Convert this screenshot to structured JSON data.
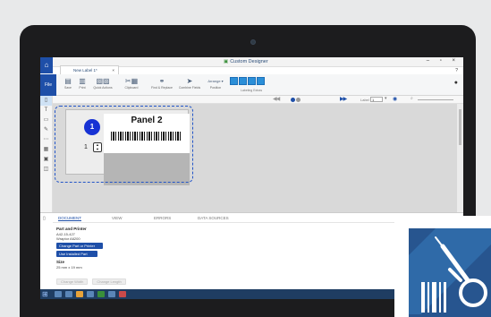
{
  "window": {
    "app_title": "Custom Designer",
    "controls": "– ▫ ×"
  },
  "document_tab": {
    "label": "New Label 1*",
    "close": "×"
  },
  "ribbon": {
    "file_label": "File",
    "buttons": [
      {
        "label": "Save",
        "icon": "save-icon"
      },
      {
        "label": "Print",
        "icon": "printer-icon"
      },
      {
        "label": "Quick Actions",
        "icon": "quick-actions-icon"
      },
      {
        "label": "Clipboard",
        "icon": "clipboard-icon"
      },
      {
        "label": "Find & Replace",
        "icon": "binoculars-icon"
      },
      {
        "label": "Combine Fields",
        "icon": "arrow-right-icon"
      },
      {
        "label": "Arrange",
        "icon": "arrange-icon"
      },
      {
        "label": "Position",
        "icon": "position-icon"
      }
    ],
    "labeling_caption": "Labeling Extras"
  },
  "navigation": {
    "label_text": "Label",
    "label_value": "1"
  },
  "panel": {
    "number": "1",
    "count": "1",
    "title": "Panel 2"
  },
  "bottom_panel": {
    "tabs": [
      "DOCUMENT",
      "VIEW",
      "ERRORS",
      "DATA SOURCES"
    ],
    "active_tab": "DOCUMENT",
    "part_heading": "Part and Printer",
    "part_number": "A42-15-427",
    "printer": "Wraptor A6200",
    "change_button": "Change Part or Printer",
    "installed_button": "Use Installed Part",
    "size_heading": "Size",
    "size_value": "25 mm x 19 mm",
    "disabled_buttons": [
      "Change Width",
      "Change Length"
    ]
  },
  "colors": {
    "accent": "#1e4fa8",
    "panel_badge": "#1732d4",
    "logo_background": "#27558f"
  }
}
